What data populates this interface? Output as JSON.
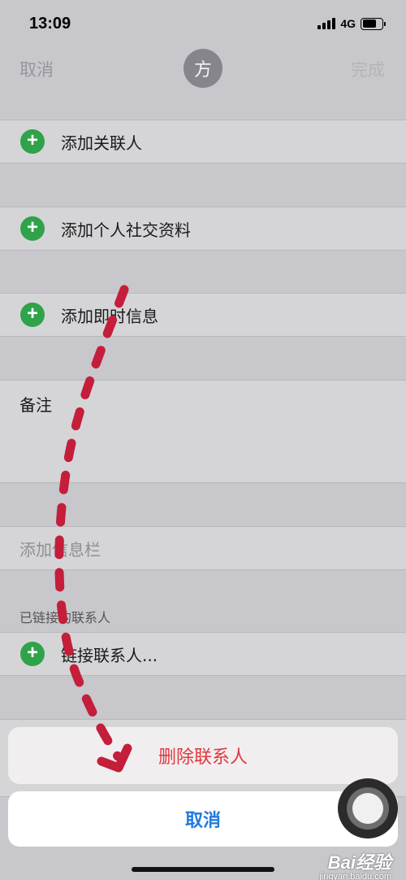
{
  "status_bar": {
    "time": "13:09",
    "network": "4G",
    "battery_level": 0.7
  },
  "nav": {
    "cancel": "取消",
    "avatar_initial": "方",
    "done": "完成"
  },
  "rows": {
    "add_related": "添加关联人",
    "add_social_profile": "添加个人社交资料",
    "add_instant_message": "添加即时信息",
    "notes": "备注",
    "add_field": "添加信息栏",
    "linked_contacts_header": "已链接的联系人",
    "link_contacts": "链接联系人..."
  },
  "action_sheet": {
    "delete_contact": "删除联系人",
    "cancel": "取消"
  },
  "colors": {
    "accent_blue": "#1f7ae0",
    "destructive_red": "#e0383e",
    "add_green": "#2fa24a",
    "annotation_red": "#c41e3a"
  },
  "icons": [
    "plus-circle-icon",
    "signal-icon",
    "battery-icon",
    "assistive-touch-icon"
  ],
  "watermark": {
    "brand": "Bai经验",
    "url": "jingyan.baidu.com"
  }
}
